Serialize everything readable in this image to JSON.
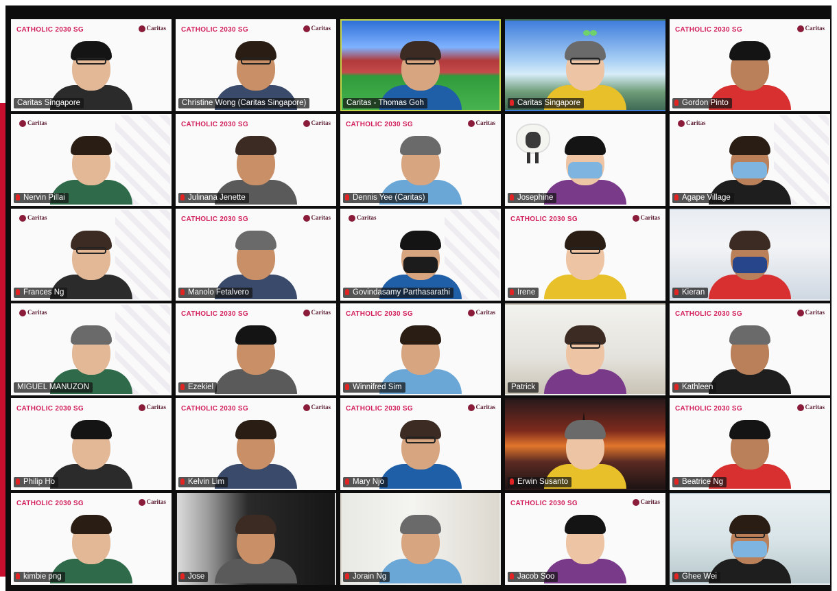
{
  "colors": {
    "accent_border": "#c9d64a",
    "mic_muted": "#e02424",
    "brand_red": "#c8102e"
  },
  "logos": {
    "catholic": "CATHOLIC 2030 SG",
    "caritas": "Caritas"
  },
  "participants": [
    {
      "name": "Caritas Singapore",
      "mic": "on",
      "bg": "logos"
    },
    {
      "name": "Christine Wong (Caritas Singapore)",
      "mic": "on",
      "bg": "logos"
    },
    {
      "name": "Caritas - Thomas Goh",
      "mic": "on",
      "bg": "stadium",
      "active": true
    },
    {
      "name": "Caritas Singapore",
      "mic": "muted",
      "bg": "sky"
    },
    {
      "name": "Gordon Pinto",
      "mic": "muted",
      "bg": "logos"
    },
    {
      "name": "Nervin Pillai",
      "mic": "muted",
      "bg": "caritas-watermark"
    },
    {
      "name": "Julinana Jenette",
      "mic": "muted",
      "bg": "logos"
    },
    {
      "name": "Dennis Yee (Caritas)",
      "mic": "muted",
      "bg": "logos"
    },
    {
      "name": "Josephine",
      "mic": "muted",
      "bg": "sheep"
    },
    {
      "name": "Agape Village",
      "mic": "muted",
      "bg": "caritas-watermark"
    },
    {
      "name": "Frances Ng",
      "mic": "muted",
      "bg": "caritas-watermark"
    },
    {
      "name": "Manolo Fetalvero",
      "mic": "muted",
      "bg": "logos"
    },
    {
      "name": "Govindasamy Parthasarathi",
      "mic": "muted",
      "bg": "caritas-watermark"
    },
    {
      "name": "Irene",
      "mic": "muted",
      "bg": "logos"
    },
    {
      "name": "Kieran",
      "mic": "muted",
      "bg": "room"
    },
    {
      "name": "MIGUEL MANUZON",
      "mic": "on",
      "bg": "caritas-watermark"
    },
    {
      "name": "Ezekiel",
      "mic": "muted",
      "bg": "logos"
    },
    {
      "name": "Winnifred Sim",
      "mic": "muted",
      "bg": "logos"
    },
    {
      "name": "Patrick",
      "mic": "on",
      "bg": "office"
    },
    {
      "name": "Kathleen",
      "mic": "muted",
      "bg": "logos"
    },
    {
      "name": "Philip Ho",
      "mic": "muted",
      "bg": "logos"
    },
    {
      "name": "Kelvin Lim",
      "mic": "muted",
      "bg": "logos"
    },
    {
      "name": "Mary Njo",
      "mic": "muted",
      "bg": "logos"
    },
    {
      "name": "Erwin Susanto",
      "mic": "muted",
      "bg": "sunset"
    },
    {
      "name": "Beatrice Ng",
      "mic": "muted",
      "bg": "logos"
    },
    {
      "name": "kimbie png",
      "mic": "muted",
      "bg": "logos"
    },
    {
      "name": "Jose",
      "mic": "muted",
      "bg": "dark"
    },
    {
      "name": "Jorain Ng",
      "mic": "muted",
      "bg": "home"
    },
    {
      "name": "Jacob Soo",
      "mic": "muted",
      "bg": "logos"
    },
    {
      "name": "Ghee Wei",
      "mic": "muted",
      "bg": "lab"
    }
  ]
}
